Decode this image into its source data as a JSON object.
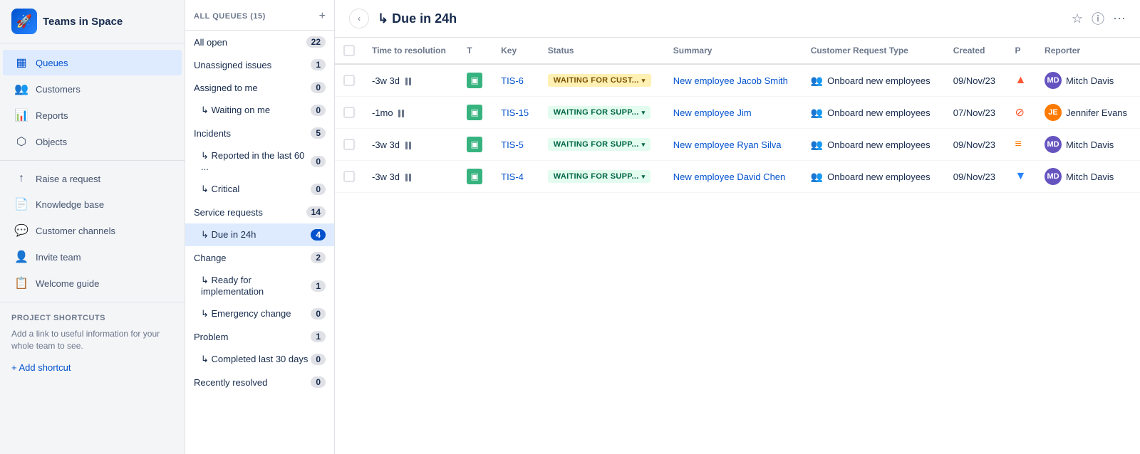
{
  "app": {
    "logo_emoji": "🚀",
    "title": "Teams in Space"
  },
  "sidebar": {
    "nav_items": [
      {
        "id": "queues",
        "label": "Queues",
        "icon": "▦",
        "active": true
      },
      {
        "id": "customers",
        "label": "Customers",
        "icon": "👥",
        "active": false
      },
      {
        "id": "reports",
        "label": "Reports",
        "icon": "📊",
        "active": false
      },
      {
        "id": "objects",
        "label": "Objects",
        "icon": "⬡",
        "active": false
      }
    ],
    "section2_items": [
      {
        "id": "raise-request",
        "label": "Raise a request",
        "icon": "↑"
      },
      {
        "id": "knowledge-base",
        "label": "Knowledge base",
        "icon": "📄"
      },
      {
        "id": "customer-channels",
        "label": "Customer channels",
        "icon": "💬"
      },
      {
        "id": "invite-team",
        "label": "Invite team",
        "icon": "👤"
      },
      {
        "id": "welcome-guide",
        "label": "Welcome guide",
        "icon": "📋"
      }
    ],
    "shortcuts_label": "Project Shortcuts",
    "shortcuts_text": "Add a link to useful information for your whole team to see.",
    "add_shortcut_label": "+ Add shortcut"
  },
  "queues": {
    "header_label": "ALL QUEUES (15)",
    "add_icon": "+",
    "items": [
      {
        "id": "all-open",
        "label": "All open",
        "count": 22,
        "indent": false
      },
      {
        "id": "unassigned-issues",
        "label": "Unassigned issues",
        "count": 1,
        "indent": false
      },
      {
        "id": "assigned-to-me",
        "label": "Assigned to me",
        "count": 0,
        "indent": false
      },
      {
        "id": "waiting-on-me",
        "label": "↳ Waiting on me",
        "count": 0,
        "indent": true
      },
      {
        "id": "incidents",
        "label": "Incidents",
        "count": 5,
        "indent": false
      },
      {
        "id": "reported-last-60",
        "label": "↳ Reported in the last 60 ...",
        "count": 0,
        "indent": true
      },
      {
        "id": "critical",
        "label": "↳ Critical",
        "count": 0,
        "indent": true
      },
      {
        "id": "service-requests",
        "label": "Service requests",
        "count": 14,
        "indent": false
      },
      {
        "id": "due-in-24h",
        "label": "↳ Due in 24h",
        "count": 4,
        "indent": true,
        "active": true
      },
      {
        "id": "change",
        "label": "Change",
        "count": 2,
        "indent": false
      },
      {
        "id": "ready-for-impl",
        "label": "↳ Ready for implementation",
        "count": 1,
        "indent": true
      },
      {
        "id": "emergency-change",
        "label": "↳ Emergency change",
        "count": 0,
        "indent": true
      },
      {
        "id": "problem",
        "label": "Problem",
        "count": 1,
        "indent": false
      },
      {
        "id": "completed-last-30",
        "label": "↳ Completed last 30 days",
        "count": 0,
        "indent": true
      },
      {
        "id": "recently-resolved",
        "label": "Recently resolved",
        "count": 0,
        "indent": false
      }
    ]
  },
  "main": {
    "title": "↳ Due in 24h",
    "collapse_icon": "‹",
    "star_icon": "☆",
    "info_icon": "ⓘ",
    "more_icon": "⋯",
    "columns": [
      {
        "id": "checkbox",
        "label": ""
      },
      {
        "id": "time-to-resolution",
        "label": "Time to resolution"
      },
      {
        "id": "type",
        "label": "T"
      },
      {
        "id": "key",
        "label": "Key"
      },
      {
        "id": "status",
        "label": "Status"
      },
      {
        "id": "summary",
        "label": "Summary"
      },
      {
        "id": "crt",
        "label": "Customer Request Type"
      },
      {
        "id": "created",
        "label": "Created"
      },
      {
        "id": "priority",
        "label": "P"
      },
      {
        "id": "reporter",
        "label": "Reporter"
      }
    ],
    "rows": [
      {
        "id": "row-1",
        "time": "-3w 3d",
        "key": "TIS-6",
        "status_label": "WAITING FOR CUST...",
        "status_type": "cust",
        "summary": "New employee Jacob Smith",
        "crt": "Onboard new employees",
        "created": "09/Nov/23",
        "priority": "up",
        "reporter_name": "Mitch Davis",
        "reporter_initials": "MD",
        "reporter_color": "purple"
      },
      {
        "id": "row-2",
        "time": "-1mo",
        "key": "TIS-15",
        "status_label": "WAITING FOR SUPP...",
        "status_type": "supp",
        "summary": "New employee Jim",
        "crt": "Onboard new employees",
        "created": "07/Nov/23",
        "priority": "stop",
        "reporter_name": "Jennifer Evans",
        "reporter_initials": "JE",
        "reporter_color": "orange"
      },
      {
        "id": "row-3",
        "time": "-3w 3d",
        "key": "TIS-5",
        "status_label": "WAITING FOR SUPP...",
        "status_type": "supp",
        "summary": "New employee Ryan Silva",
        "crt": "Onboard new employees",
        "created": "09/Nov/23",
        "priority": "med",
        "reporter_name": "Mitch Davis",
        "reporter_initials": "MD",
        "reporter_color": "purple"
      },
      {
        "id": "row-4",
        "time": "-3w 3d",
        "key": "TIS-4",
        "status_label": "WAITING FOR SUPP...",
        "status_type": "supp",
        "summary": "New employee David Chen",
        "crt": "Onboard new employees",
        "created": "09/Nov/23",
        "priority": "low",
        "reporter_name": "Mitch Davis",
        "reporter_initials": "MD",
        "reporter_color": "purple"
      }
    ]
  }
}
